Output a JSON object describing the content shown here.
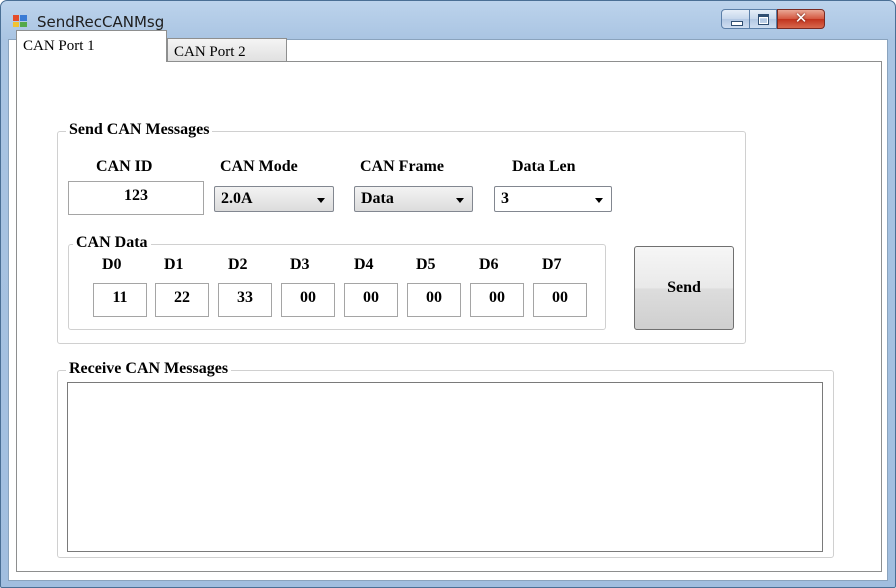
{
  "window": {
    "title": "SendRecCANMsg"
  },
  "tabs": [
    {
      "label": "CAN Port 1",
      "selected": true
    },
    {
      "label": "CAN Port 2",
      "selected": false
    }
  ],
  "send_group": {
    "legend": "Send CAN Messages",
    "can_id": {
      "label": "CAN ID",
      "value": "123"
    },
    "can_mode": {
      "label": "CAN Mode",
      "value": "2.0A"
    },
    "can_frame": {
      "label": "CAN Frame",
      "value": "Data"
    },
    "data_len": {
      "label": "Data Len",
      "value": "3"
    },
    "can_data": {
      "legend": "CAN Data",
      "bytes": [
        {
          "label": "D0",
          "value": "11"
        },
        {
          "label": "D1",
          "value": "22"
        },
        {
          "label": "D2",
          "value": "33"
        },
        {
          "label": "D3",
          "value": "00"
        },
        {
          "label": "D4",
          "value": "00"
        },
        {
          "label": "D5",
          "value": "00"
        },
        {
          "label": "D6",
          "value": "00"
        },
        {
          "label": "D7",
          "value": "00"
        }
      ]
    },
    "send_label": "Send"
  },
  "receive_group": {
    "legend": "Receive CAN Messages"
  }
}
